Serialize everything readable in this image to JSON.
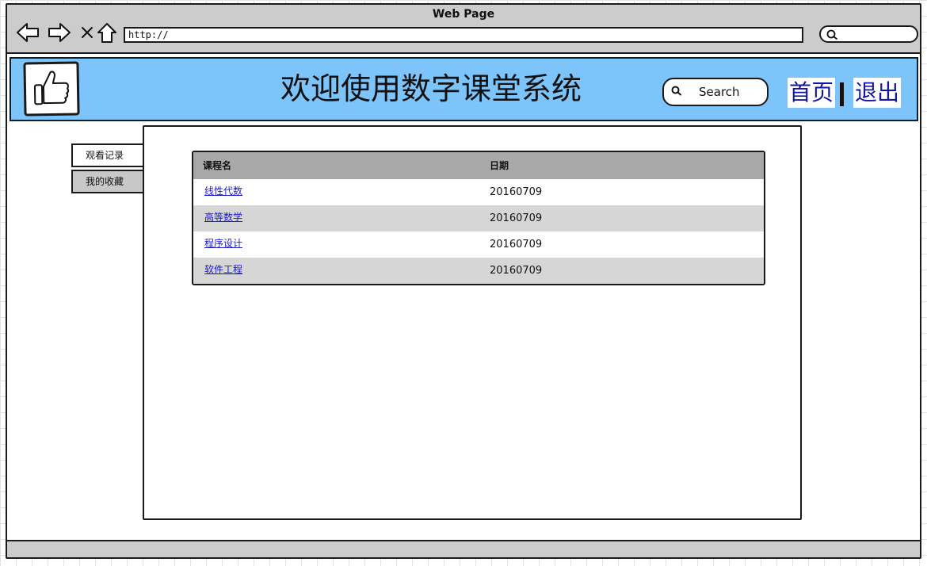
{
  "browser": {
    "window_title": "Web Page",
    "url": "http://"
  },
  "header": {
    "title": "欢迎使用数字课堂系统",
    "search_placeholder": "Search",
    "nav_home": "首页",
    "nav_logout": "退出"
  },
  "tabs": [
    {
      "label": "观看记录",
      "active": true
    },
    {
      "label": "我的收藏",
      "active": false
    }
  ],
  "table": {
    "columns": [
      "课程名",
      "日期"
    ],
    "rows": [
      {
        "course": "线性代数",
        "date": "20160709"
      },
      {
        "course": "高等数学",
        "date": "20160709"
      },
      {
        "course": "程序设计",
        "date": "20160709"
      },
      {
        "course": "软件工程",
        "date": "20160709"
      }
    ]
  },
  "colors": {
    "header_bg": "#7cc4fa",
    "chrome_bg": "#cccccc",
    "link": "#1a1ad0",
    "nav_link": "#1515a0",
    "table_header_bg": "#a8a8a8",
    "table_alt_row": "#d6d6d6"
  },
  "icons": [
    "back-arrow-icon",
    "forward-arrow-icon",
    "close-icon",
    "home-icon",
    "search-icon",
    "thumbs-up-icon"
  ]
}
